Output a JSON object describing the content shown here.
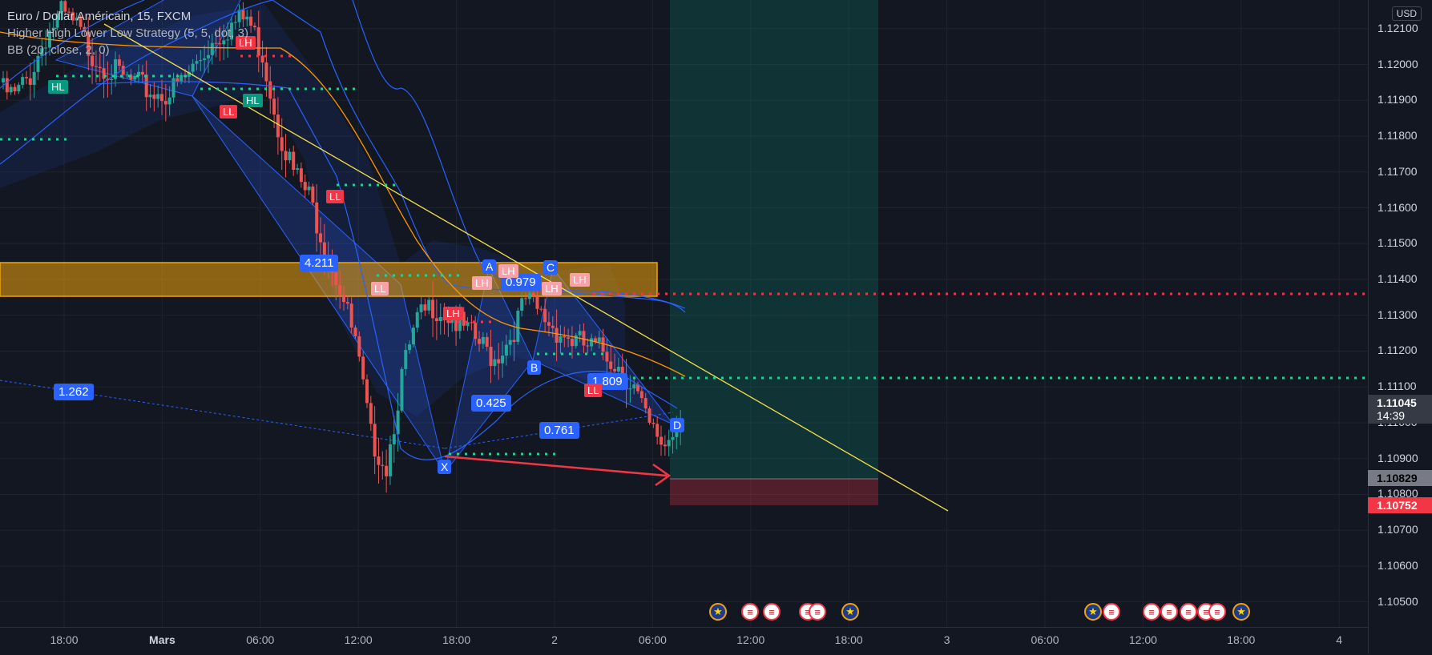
{
  "header": {
    "symbol": "Euro / Dollar Américain, 15, FXCM",
    "indicator_1": "Higher High Lower Low Strategy (5, 5, dot, 3)",
    "indicator_2": "BB (20, close, 2, 0)",
    "currency": "USD"
  },
  "price_axis": {
    "ticks": [
      "1.12100",
      "1.12000",
      "1.11900",
      "1.11800",
      "1.11700",
      "1.11600",
      "1.11500",
      "1.11400",
      "1.11300",
      "1.11200",
      "1.11100",
      "1.11000",
      "1.10900",
      "1.10800",
      "1.10700",
      "1.10600",
      "1.10500"
    ],
    "current_price": "1.11045",
    "countdown": "14:39",
    "take_profit_label": "1.10829",
    "stop_loss_label": "1.10752"
  },
  "time_axis": {
    "ticks": [
      {
        "label": "18:00",
        "bold": false
      },
      {
        "label": "Mars",
        "bold": true
      },
      {
        "label": "06:00",
        "bold": false
      },
      {
        "label": "12:00",
        "bold": false
      },
      {
        "label": "18:00",
        "bold": false
      },
      {
        "label": "2",
        "bold": false
      },
      {
        "label": "06:00",
        "bold": false
      },
      {
        "label": "12:00",
        "bold": false
      },
      {
        "label": "18:00",
        "bold": false
      },
      {
        "label": "3",
        "bold": false
      },
      {
        "label": "06:00",
        "bold": false
      },
      {
        "label": "12:00",
        "bold": false
      },
      {
        "label": "18:00",
        "bold": false
      },
      {
        "label": "4",
        "bold": false
      }
    ]
  },
  "harmonic": {
    "points": [
      "X",
      "A",
      "B",
      "C",
      "D"
    ],
    "ratios": [
      "4.211",
      "0.979",
      "1.809",
      "0.425",
      "0.761",
      "1.262"
    ]
  },
  "pivot_tags": [
    "HL",
    "LH",
    "LL",
    "LL",
    "LL",
    "LH",
    "LH",
    "LH",
    "LH",
    "LL",
    "HL",
    "LH"
  ],
  "colors": {
    "background": "#131722",
    "bull": "#26a69a",
    "bear": "#ef5350",
    "pattern_blue": "#2962ff",
    "trendline": "#f7e04b",
    "zone": "#f0a30a",
    "arrow": "#f23645"
  },
  "chart_data": {
    "type": "candlestick",
    "instrument": "Euro / Dollar Américain",
    "timeframe": "15",
    "ylim": [
      1.1043,
      1.1218
    ],
    "resistance_zone": [
      1.11355,
      1.11445
    ],
    "resistance_level": 1.11355,
    "support_level": 1.11115,
    "entry_price": 1.10829,
    "stop_loss": 1.10752,
    "current_price": 1.11045,
    "pattern_points": [
      {
        "name": "X",
        "price": 1.1088
      },
      {
        "name": "A",
        "price": 1.1144
      },
      {
        "name": "B",
        "price": 1.1117
      },
      {
        "name": "C",
        "price": 1.1142
      },
      {
        "name": "D",
        "price": 1.1096
      }
    ],
    "close_path": [
      1.1195,
      1.1193,
      1.1199,
      1.121,
      1.1216,
      1.1212,
      1.1205,
      1.1201,
      1.1198,
      1.1196,
      1.1194,
      1.1194,
      1.1198,
      1.1204,
      1.121,
      1.1213,
      1.1215,
      1.1205,
      1.1185,
      1.1172,
      1.1165,
      1.1152,
      1.114,
      1.1124,
      1.1098,
      1.109,
      1.1115,
      1.113,
      1.1135,
      1.1132,
      1.1128,
      1.1124,
      1.112,
      1.1126,
      1.1136,
      1.1132,
      1.1128,
      1.1125,
      1.1123,
      1.1122,
      1.1118,
      1.1112,
      1.11,
      1.1096,
      1.1104
    ]
  }
}
